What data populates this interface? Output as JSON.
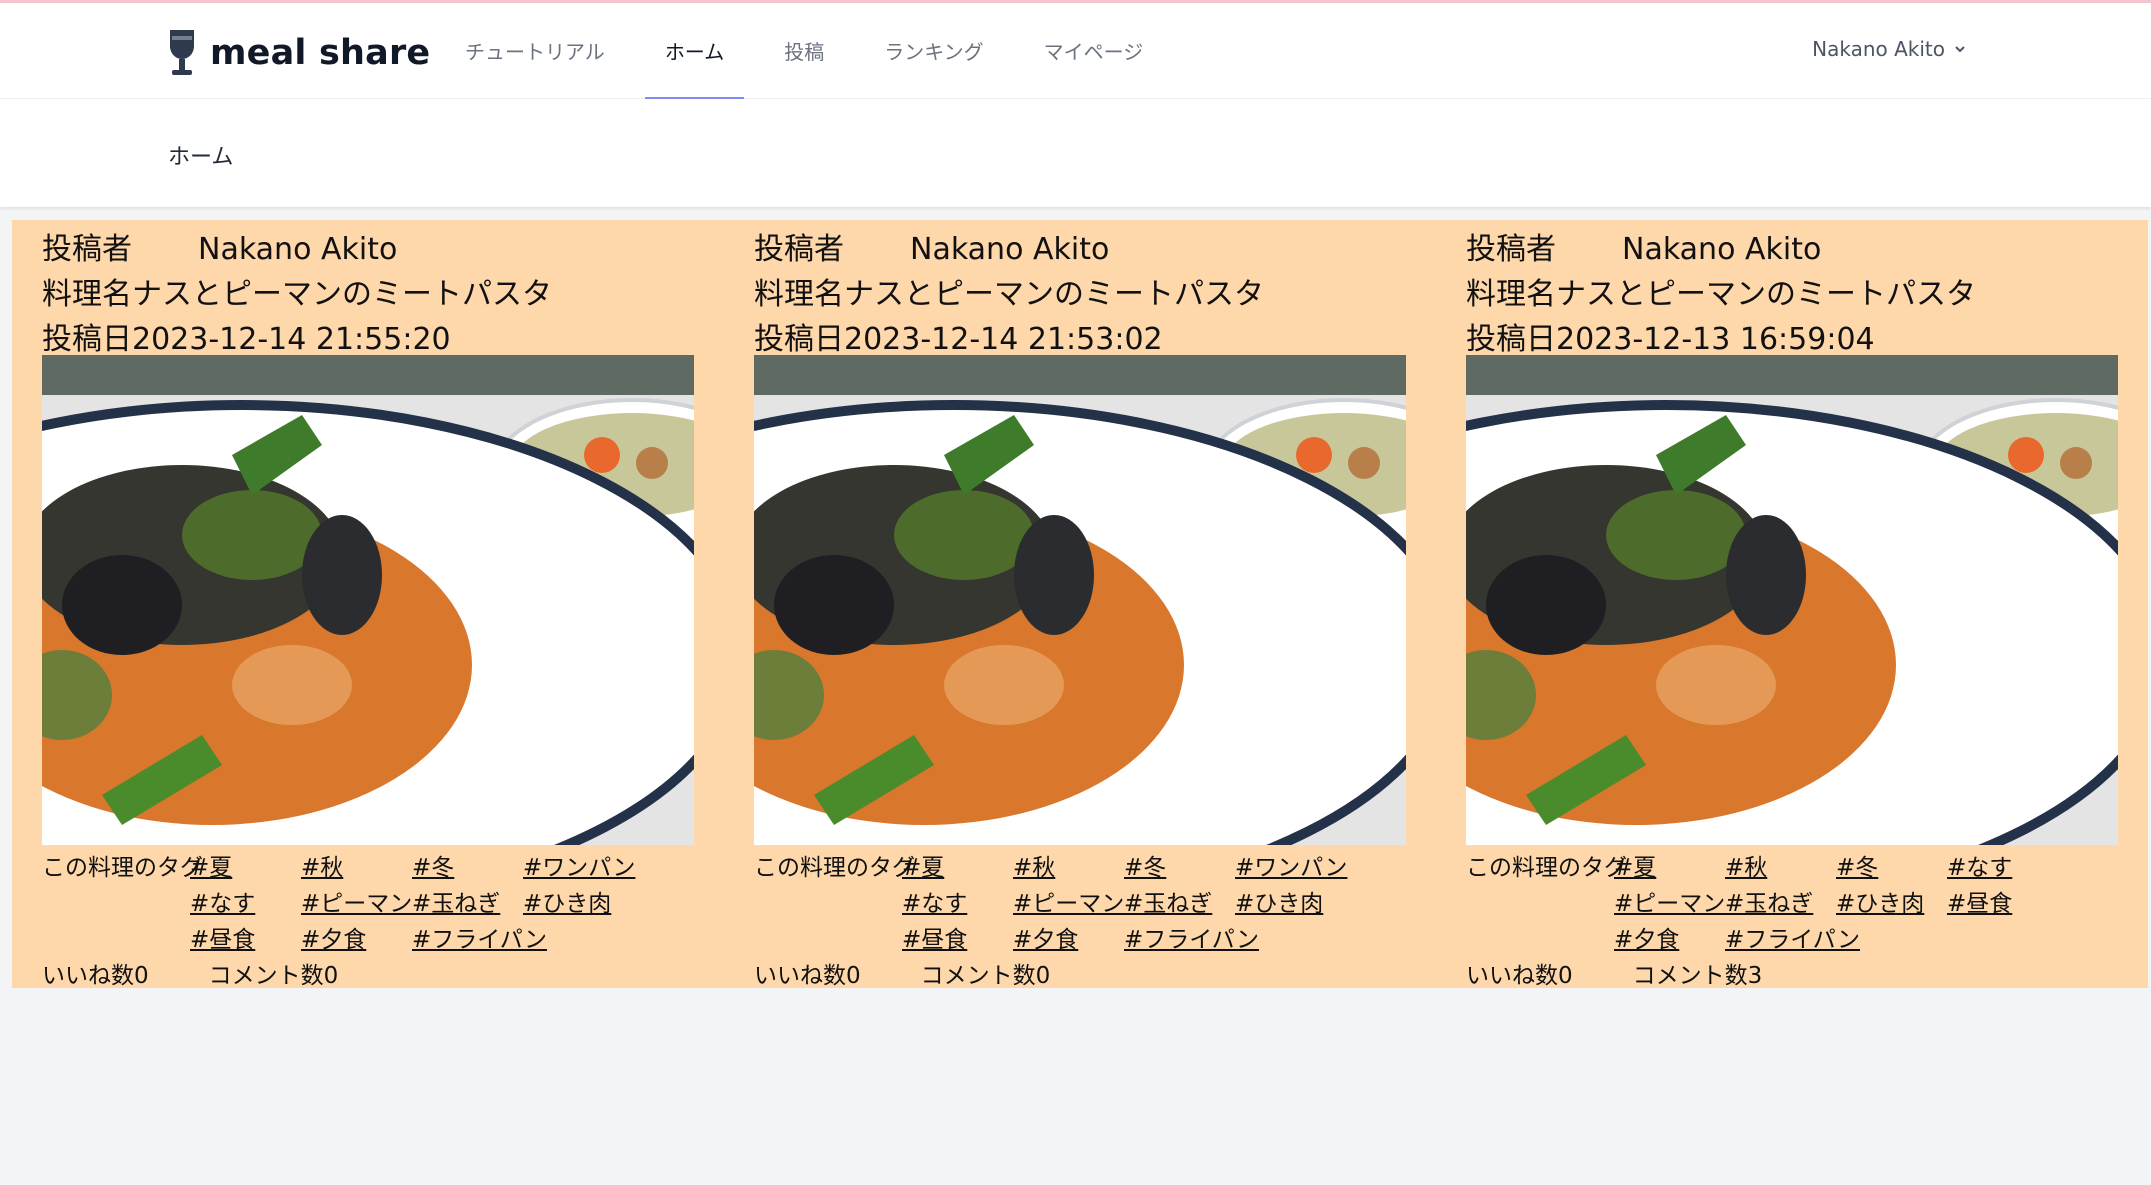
{
  "app": {
    "name": "meal share"
  },
  "nav": {
    "items": [
      "チュートリアル",
      "ホーム",
      "投稿",
      "ランキング",
      "マイページ"
    ],
    "active": "ホーム"
  },
  "user": {
    "name": "Nakano Akito"
  },
  "page": {
    "title": "ホーム"
  },
  "labels": {
    "author": "投稿者",
    "dish": "料理名",
    "date": "投稿日",
    "tags": "この料理のタグ",
    "likes": "いいね数",
    "comments": "コメント数"
  },
  "posts": [
    {
      "author": "Nakano Akito",
      "dish": "ナスとピーマンのミートパスタ",
      "date": "2023-12-14 21:55:20",
      "tags": [
        "#夏",
        "#秋",
        "#冬",
        "#ワンパン",
        "#なす",
        "#ピーマン",
        "#玉ねぎ",
        "#ひき肉",
        "#昼食",
        "#夕食",
        "#フライパン"
      ],
      "likes": "0",
      "comments": "0"
    },
    {
      "author": "Nakano Akito",
      "dish": "ナスとピーマンのミートパスタ",
      "date": "2023-12-14 21:53:02",
      "tags": [
        "#夏",
        "#秋",
        "#冬",
        "#ワンパン",
        "#なす",
        "#ピーマン",
        "#玉ねぎ",
        "#ひき肉",
        "#昼食",
        "#夕食",
        "#フライパン"
      ],
      "likes": "0",
      "comments": "0"
    },
    {
      "author": "Nakano Akito",
      "dish": "ナスとピーマンのミートパスタ",
      "date": "2023-12-13 16:59:04",
      "tags": [
        "#夏",
        "#秋",
        "#冬",
        "#なす",
        "#ピーマン",
        "#玉ねぎ",
        "#ひき肉",
        "#昼食",
        "#夕食",
        "#フライパン"
      ],
      "likes": "0",
      "comments": "3"
    }
  ],
  "colors": {
    "feed_bg": "#fed7aa",
    "nav_active": "#818cf8",
    "page_bg": "#f3f4f6"
  }
}
